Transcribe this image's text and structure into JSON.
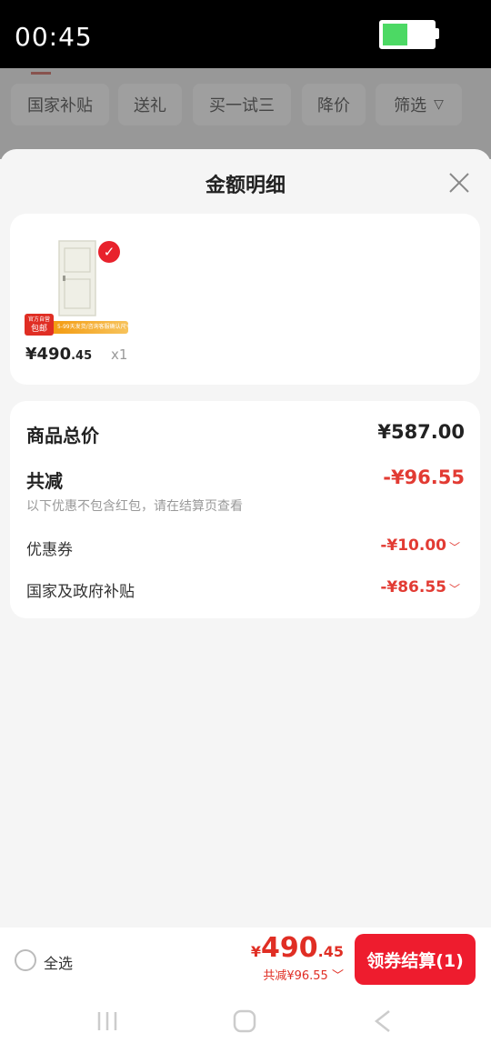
{
  "status_bar": {
    "time": "00:45",
    "battery_level": 0.5,
    "battery_color": "#4cd964"
  },
  "filter_chips": [
    "国家补贴",
    "送礼",
    "买一试三",
    "降价",
    "筛选"
  ],
  "sheet": {
    "title": "金额明细",
    "product": {
      "badge_top": "官方自营",
      "badge_main": "包邮",
      "badge_strip": "5-99天发货/咨询客服确认尺寸",
      "price_int": "¥490",
      "price_dec": ".45",
      "quantity": "x1"
    },
    "details": {
      "goods_total_label": "商品总价",
      "goods_total_value": "¥587.00",
      "total_discount_label": "共减",
      "total_discount_value": "-¥96.55",
      "note": "以下优惠不包含红包，请在结算页查看",
      "coupon_label": "优惠券",
      "coupon_value": "-¥10.00",
      "subsidy_label": "国家及政府补贴",
      "subsidy_value": "-¥86.55"
    }
  },
  "bottom_bar": {
    "select_all_label": "全选",
    "price_symbol": "¥",
    "price_int": "490",
    "price_dec": ".45",
    "saving_text": "共减¥96.55",
    "checkout_label": "领券结算(1)"
  },
  "colors": {
    "accent": "#e02e24",
    "checkout": "#ee1c2e"
  }
}
